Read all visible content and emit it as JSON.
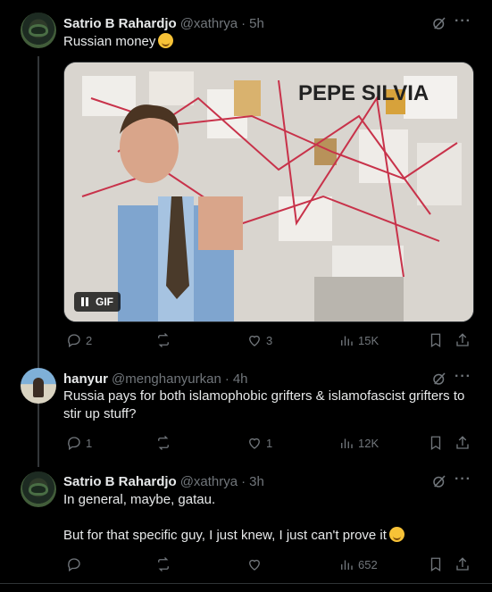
{
  "tweets": [
    {
      "name": "Satrio B Rahardjo",
      "handle": "@xathrya",
      "sep": "·",
      "time": "5h",
      "text": "Russian money",
      "media": {
        "type": "gif",
        "badge": "GIF",
        "graffiti": "PEPE SILVIA"
      },
      "stats": {
        "replies": "2",
        "reposts": "",
        "likes": "3",
        "views": "15K"
      }
    },
    {
      "name": "hanyur",
      "handle": "@menghanyurkan",
      "sep": "·",
      "time": "4h",
      "text": "Russia pays for both islamophobic grifters & islamofascist grifters to stir up stuff?",
      "stats": {
        "replies": "1",
        "reposts": "",
        "likes": "1",
        "views": "12K"
      }
    },
    {
      "name": "Satrio B Rahardjo",
      "handle": "@xathrya",
      "sep": "·",
      "time": "3h",
      "text_line1": "In general, maybe, gatau.",
      "text_line2": "But for that specific guy, I just knew, I just can't prove it",
      "stats": {
        "replies": "",
        "reposts": "",
        "likes": "",
        "views": "652"
      }
    }
  ],
  "icons": {
    "grok": "grok-icon",
    "more": "more-icon",
    "reply": "reply-icon",
    "repost": "repost-icon",
    "like": "like-icon",
    "views": "views-icon",
    "bookmark": "bookmark-icon",
    "share": "share-icon"
  },
  "colors": {
    "background": "#000000",
    "text": "#e7e9ea",
    "muted": "#71767b",
    "border": "#2f3336"
  }
}
